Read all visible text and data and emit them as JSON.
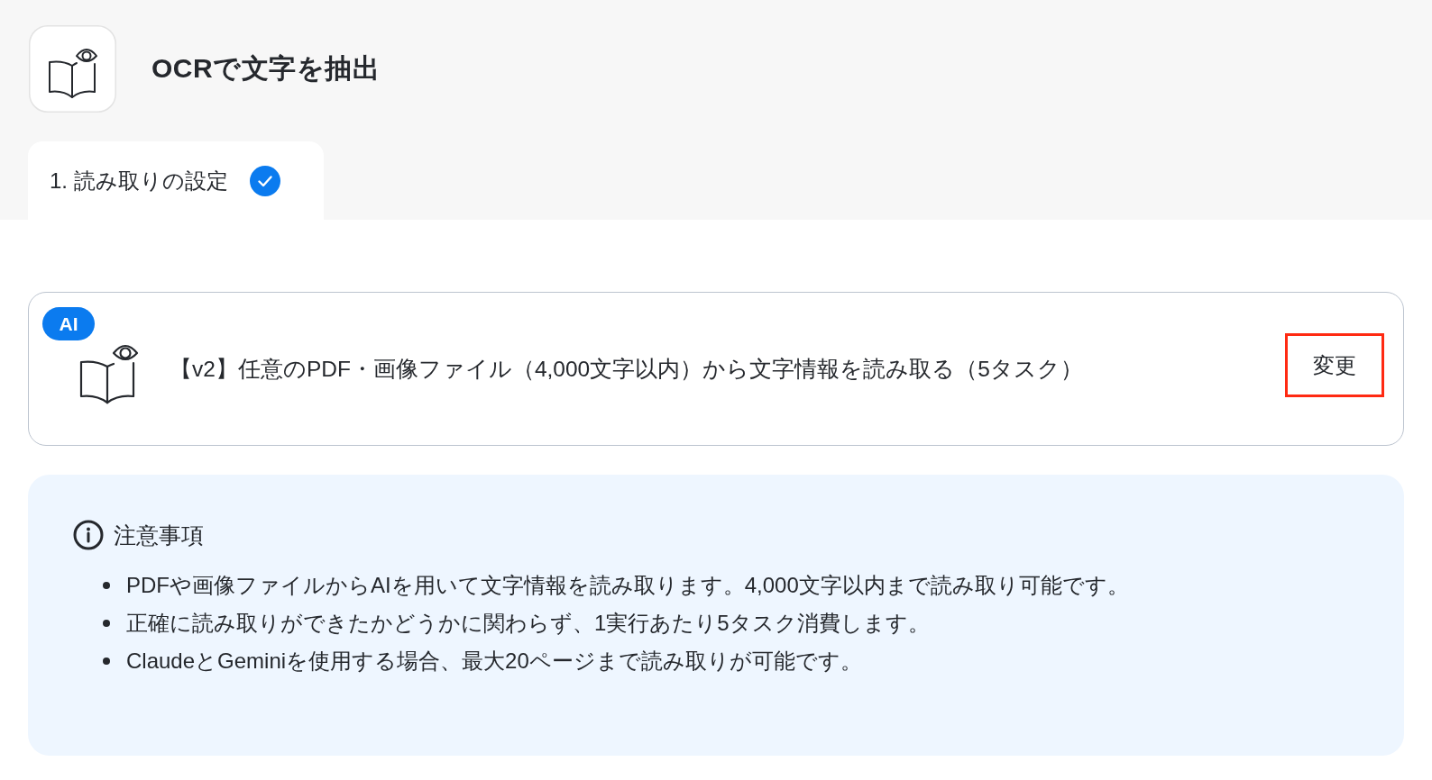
{
  "app": {
    "title": "OCRで文字を抽出"
  },
  "tabs": [
    {
      "label": "1. 読み取りの設定",
      "selected": true,
      "completed": true
    }
  ],
  "action_card": {
    "badge": "AI",
    "description": "【v2】任意のPDF・画像ファイル（4,000文字以内）から文字情報を読み取る（5タスク）",
    "button": {
      "label": "変更",
      "highlighted": true
    }
  },
  "notice": {
    "title": "注意事項",
    "items": [
      "PDFや画像ファイルからAIを用いて文字情報を読み取ります。4,000文字以内まで読み取り可能です。",
      "正確に読み取りができたかどうかに関わらず、1実行あたり5タスク消費します。",
      "ClaudeとGeminiを使用する場合、最大20ページまで読み取りが可能です。"
    ]
  }
}
